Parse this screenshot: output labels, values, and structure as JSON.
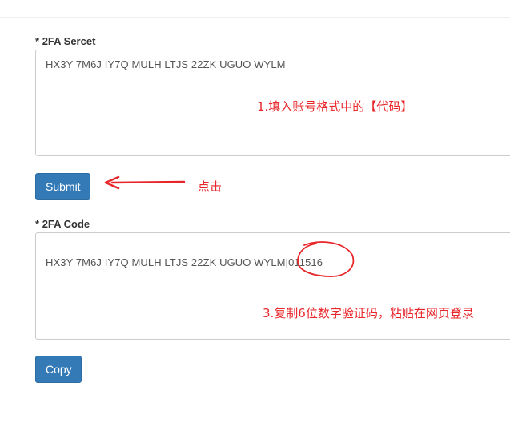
{
  "secret_field": {
    "required_mark": "*",
    "label": "2FA Sercet",
    "value": "HX3Y 7M6J IY7Q MULH LTJS 22ZK UGUO WYLM"
  },
  "submit_button": {
    "label": "Submit"
  },
  "code_field": {
    "required_mark": "*",
    "label": "2FA Code",
    "value": "HX3Y 7M6J IY7Q MULH LTJS 22ZK UGUO WYLM|011516"
  },
  "copy_button": {
    "label": "Copy"
  },
  "annotations": {
    "step1": "1.填入账号格式中的【代码】",
    "step2": "点击",
    "step3": "3.复制6位数字验证码，粘贴在网页登录",
    "color": "#e8262a"
  },
  "colors": {
    "primary_button": "#337ab7",
    "input_border": "#cccccc"
  }
}
